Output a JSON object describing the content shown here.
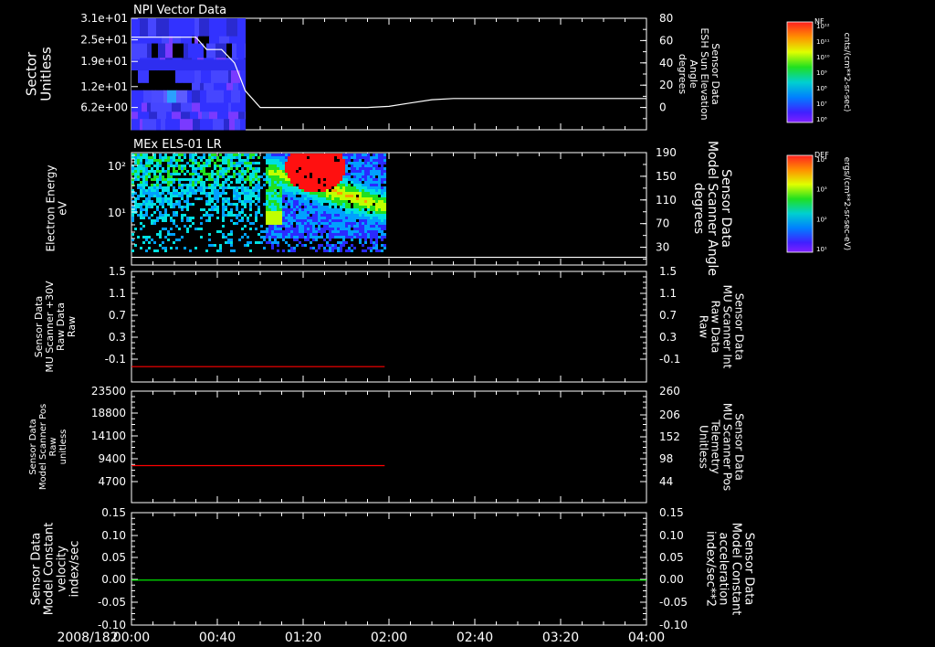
{
  "date_label": "2008/182",
  "time_axis": {
    "ticks": [
      "00:00",
      "00:40",
      "01:20",
      "02:00",
      "02:40",
      "03:20",
      "04:00"
    ],
    "range_min": [
      0,
      240
    ]
  },
  "chart_data": [
    {
      "type": "heatmap",
      "title": "NPI Vector Data",
      "ylabel": "Sector\nUnitless",
      "y_ticks": [
        "3.1e+01",
        "2.5e+01",
        "1.9e+01",
        "1.2e+01",
        "6.2e+00"
      ],
      "y_range": [
        0,
        31
      ],
      "data_time_range_min": [
        0,
        53
      ],
      "right_axis": {
        "label": "Sensor Data\nESH Sun Elevation\nAngle\ndegrees",
        "ticks": [
          "80",
          "60",
          "40",
          "20",
          "0"
        ],
        "range": [
          -20,
          80
        ]
      },
      "overlay_line": {
        "series": "Sun Elevation Angle",
        "color": "#ffffff",
        "x_min": [
          0,
          30,
          35,
          42,
          48,
          53,
          60,
          95,
          100,
          110,
          120,
          130,
          140,
          150,
          160,
          200,
          240
        ],
        "y": [
          63,
          63,
          52,
          52,
          40,
          15,
          0,
          0,
          0,
          0,
          1,
          4,
          7,
          8,
          8,
          8,
          8
        ]
      },
      "colorbar": {
        "label": "NF",
        "units": "cnts/(cm**2-sr-sec)",
        "ticks": [
          "10¹²",
          "10¹¹",
          "10¹⁰",
          "10⁹",
          "10⁸",
          "10⁷",
          "10⁶"
        ]
      }
    },
    {
      "type": "heatmap",
      "title": "MEx ELS-01 LR",
      "ylabel": "Electron Energy\neV",
      "y_ticks": [
        "10²",
        "10¹"
      ],
      "y_scale": "log",
      "data_time_range_min": [
        0,
        118
      ],
      "right_axis": {
        "label": "Sensor Data\nModel Scanner Angle\ndegrees",
        "ticks": [
          "190",
          "150",
          "110",
          "70",
          "30"
        ],
        "range": [
          0,
          190
        ]
      },
      "overlay_line": {
        "series": "Scanner Angle",
        "color": "#ffffff",
        "value": 3
      },
      "colorbar": {
        "label": "DEF",
        "units": "ergs/(cm**2-sr-sec-eV)",
        "ticks": [
          "10⁴",
          "10³",
          "10²",
          "10¹"
        ]
      }
    },
    {
      "type": "line",
      "ylabel": "Sensor Data\nMU Scanner +30V\nRaw Data\nRaw",
      "y_ticks": [
        "1.5",
        "1.1",
        "0.7",
        "0.3",
        "-0.1"
      ],
      "y_range": [
        -0.3,
        1.5
      ],
      "right_label": "Sensor Data\nMU Scanner Int\nRaw Data\nRaw",
      "right_ticks": [
        "1.5",
        "1.1",
        "0.7",
        "0.3",
        "-0.1"
      ],
      "series": [
        {
          "color": "#ff0000",
          "x_min": [
            0,
            118
          ],
          "y": [
            -0.05,
            -0.05
          ]
        }
      ]
    },
    {
      "type": "line",
      "ylabel": "Sensor Data\nModel Scanner Pos\nRaw\nunitless",
      "y_ticks": [
        "23500",
        "18800",
        "14100",
        "9400",
        "4700"
      ],
      "y_range": [
        0,
        23500
      ],
      "right_label": "Sensor Data\nMU Scanner Pos\nTelemetry\nUnitless",
      "right_ticks": [
        "260",
        "206",
        "152",
        "98",
        "44"
      ],
      "series": [
        {
          "color": "#ff0000",
          "x_min": [
            0,
            118
          ],
          "y": [
            7800,
            7800
          ]
        }
      ]
    },
    {
      "type": "line",
      "ylabel": "Sensor Data\nModel Constant\nvelocity\nindex/sec",
      "y_ticks": [
        "0.15",
        "0.10",
        "0.05",
        "0.00",
        "-0.05",
        "-0.10"
      ],
      "y_range": [
        -0.1,
        0.15
      ],
      "right_label": "Sensor Data\nModel Constant\nacceleration\nindex/sec**2",
      "right_ticks": [
        "0.15",
        "0.10",
        "0.05",
        "0.00",
        "-0.05",
        "-0.10"
      ],
      "series": [
        {
          "color": "#00ff00",
          "x_min": [
            0,
            240
          ],
          "y": [
            0,
            0
          ]
        }
      ]
    }
  ],
  "colors": {
    "background": "#000000",
    "axis": "#ffffff",
    "red_label": "#ff0000",
    "green_label": "#00ff00"
  }
}
